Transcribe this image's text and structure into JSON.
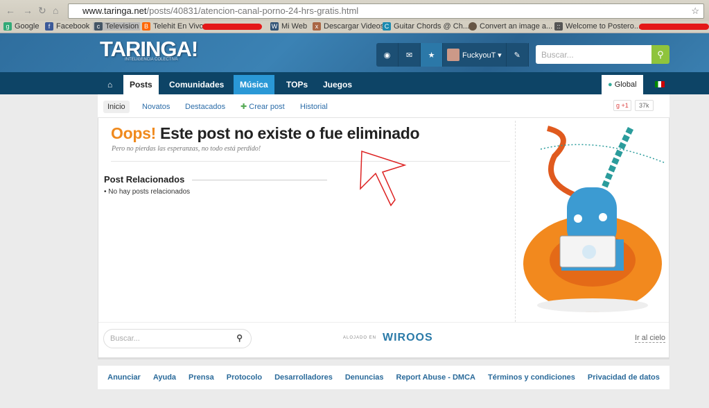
{
  "browser": {
    "url_domain": "www.taringa.net",
    "url_path": "/posts/40831/atencion-canal-porno-24-hrs-gratis.html",
    "bookmarks": [
      "Google",
      "Facebook",
      "Television",
      "Telehit En Vivo",
      "Mi Web",
      "Descargar Videos",
      "Guitar Chords @ Ch...",
      "Convert an image a...",
      "Welcome to Postero..."
    ]
  },
  "header": {
    "logo": "TARINGA!",
    "tagline": "INTELIGENCIA COLECTIVA",
    "username": "FuckyouT ▾",
    "search_placeholder": "Buscar..."
  },
  "nav": {
    "tabs": [
      "Posts",
      "Comunidades",
      "Música",
      "TOPs",
      "Juegos"
    ],
    "global": "Global"
  },
  "subnav": {
    "items": [
      "Inicio",
      "Novatos",
      "Destacados",
      "Crear post",
      "Historial"
    ],
    "gplus": "+1",
    "count": "37k"
  },
  "main": {
    "oops": "Oops!",
    "title": " Este post no existe o fue eliminado",
    "subtitle": "Pero no pierdas las esperanzas, no todo está perdido!",
    "related_title": "Post Relacionados",
    "related_empty": "No hay posts relacionados"
  },
  "card_footer": {
    "search_placeholder": "Buscar...",
    "hosted": "ALOJADO EN",
    "host": "WIROOS",
    "top": "Ir al cielo"
  },
  "footer": {
    "links": [
      "Anunciar",
      "Ayuda",
      "Prensa",
      "Protocolo",
      "Desarrolladores",
      "Denuncias",
      "Report Abuse - DMCA",
      "Términos y condiciones",
      "Privacidad de datos"
    ]
  },
  "colors": {
    "accent": "#2a98d6",
    "oops": "#f08a1e",
    "search_btn": "#8fc43c"
  }
}
